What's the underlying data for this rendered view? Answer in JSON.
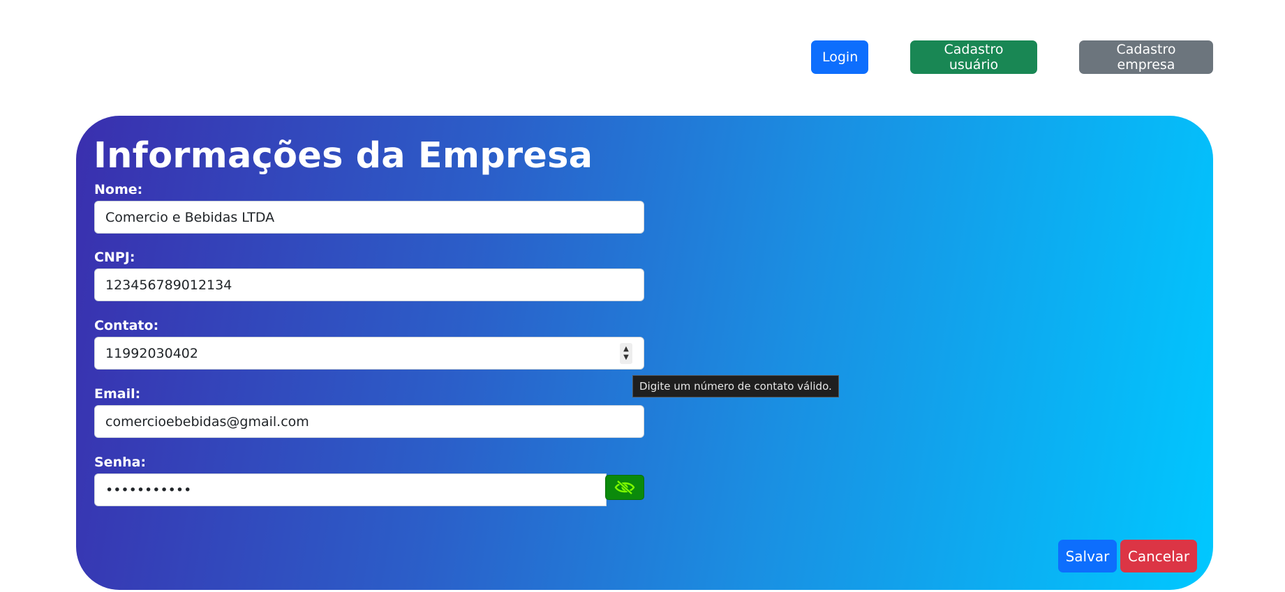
{
  "nav": {
    "login_label": "Login",
    "cadastro_usuario_label": "Cadastro usuário",
    "cadastro_empresa_label": "Cadastro empresa"
  },
  "form": {
    "title": "Informações da Empresa",
    "nome": {
      "label": "Nome:",
      "value": "Comercio e Bebidas LTDA"
    },
    "cnpj": {
      "label": "CNPJ:",
      "value": "123456789012134"
    },
    "contato": {
      "label": "Contato:",
      "value": "11992030402"
    },
    "email": {
      "label": "Email:",
      "value": "comercioebebidas@gmail.com"
    },
    "senha": {
      "label": "Senha:",
      "value": "•••••••••••"
    },
    "toggle_password_icon": "eye-slash-icon",
    "tooltip": "Digite um número de contato válido.",
    "salvar_label": "Salvar",
    "cancelar_label": "Cancelar"
  },
  "colors": {
    "primary": "#0d6efd",
    "success": "#198754",
    "secondary": "#6c757d",
    "danger": "#dc3545",
    "eye_button": "#0b8a0b",
    "gradient_start": "#3a2fae",
    "gradient_end": "#00c8ff"
  }
}
